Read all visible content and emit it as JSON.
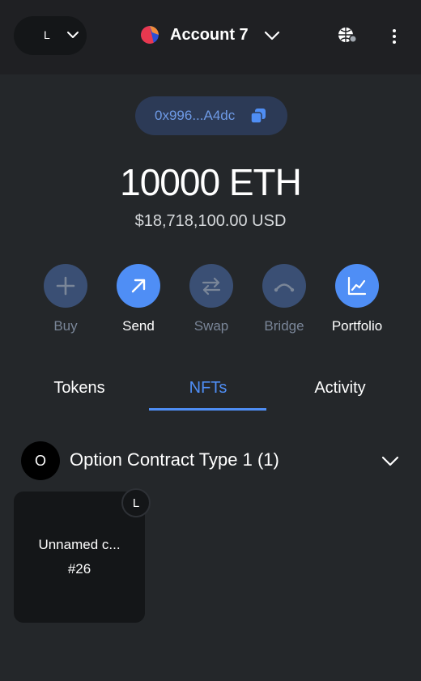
{
  "header": {
    "network_letter": "L",
    "account_name": "Account 7"
  },
  "address": {
    "short": "0x996...A4dc"
  },
  "balance": {
    "crypto": "10000 ETH",
    "fiat": "$18,718,100.00 USD"
  },
  "actions": [
    {
      "label": "Buy",
      "icon": "plus-icon",
      "enabled": false
    },
    {
      "label": "Send",
      "icon": "arrow-up-right-icon",
      "enabled": true
    },
    {
      "label": "Swap",
      "icon": "swap-icon",
      "enabled": false
    },
    {
      "label": "Bridge",
      "icon": "bridge-icon",
      "enabled": false
    },
    {
      "label": "Portfolio",
      "icon": "chart-icon",
      "enabled": true
    }
  ],
  "tabs": [
    {
      "label": "Tokens",
      "selected": false
    },
    {
      "label": "NFTs",
      "selected": true
    },
    {
      "label": "Activity",
      "selected": false
    }
  ],
  "collection": {
    "avatar_letter": "O",
    "name": "Option Contract Type 1 (1)"
  },
  "nfts": [
    {
      "name": "Unnamed c...",
      "id": "#26",
      "badge": "L"
    }
  ],
  "colors": {
    "accent": "#4f8ef5",
    "background": "#24272a",
    "header": "#1f2023",
    "card": "#141618",
    "address_text": "#6e9ae6"
  }
}
